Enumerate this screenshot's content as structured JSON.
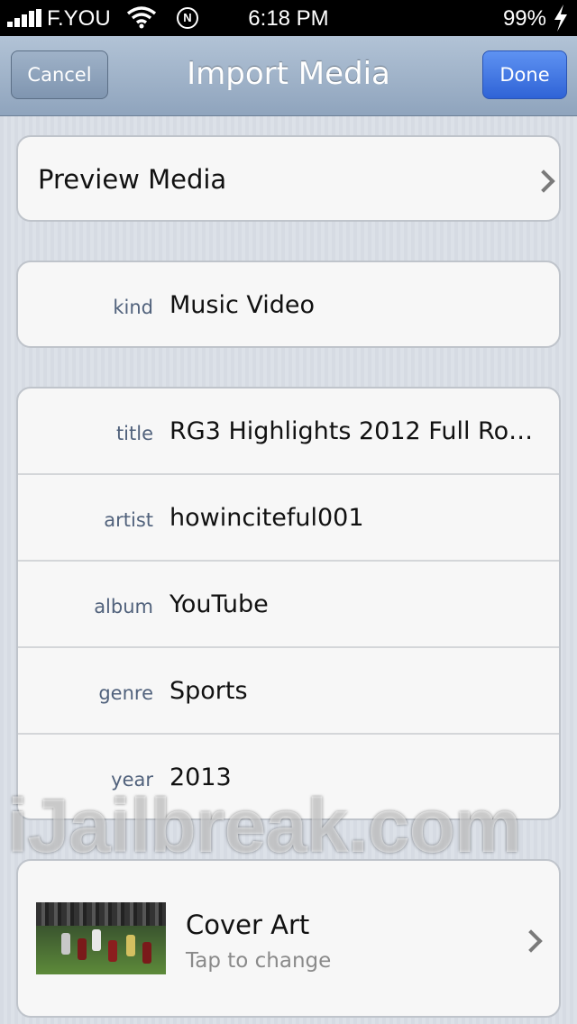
{
  "status_bar": {
    "carrier": "F.YOU",
    "time": "6:18 PM",
    "battery": "99%",
    "icons": [
      "signal-icon",
      "wifi-icon",
      "navigation-icon",
      "charging-bolt-icon"
    ]
  },
  "navbar": {
    "title": "Import Media",
    "cancel_label": "Cancel",
    "done_label": "Done"
  },
  "preview": {
    "label": "Preview Media",
    "icon": "chevron-right-icon"
  },
  "kind": {
    "label": "kind",
    "value": "Music Video"
  },
  "metadata": [
    {
      "label": "title",
      "value": "RG3 Highlights 2012 Full Roo…"
    },
    {
      "label": "artist",
      "value": "howinciteful001"
    },
    {
      "label": "album",
      "value": "YouTube"
    },
    {
      "label": "genre",
      "value": "Sports"
    },
    {
      "label": "year",
      "value": "2013"
    }
  ],
  "cover_art": {
    "title": "Cover Art",
    "subtitle": "Tap to change",
    "icon": "chevron-right-icon"
  },
  "watermark": "iJailbreak.com",
  "colors": {
    "done_button": "#3b6fe0",
    "navbar": "#9fb2c8",
    "label_text": "#51627c"
  }
}
